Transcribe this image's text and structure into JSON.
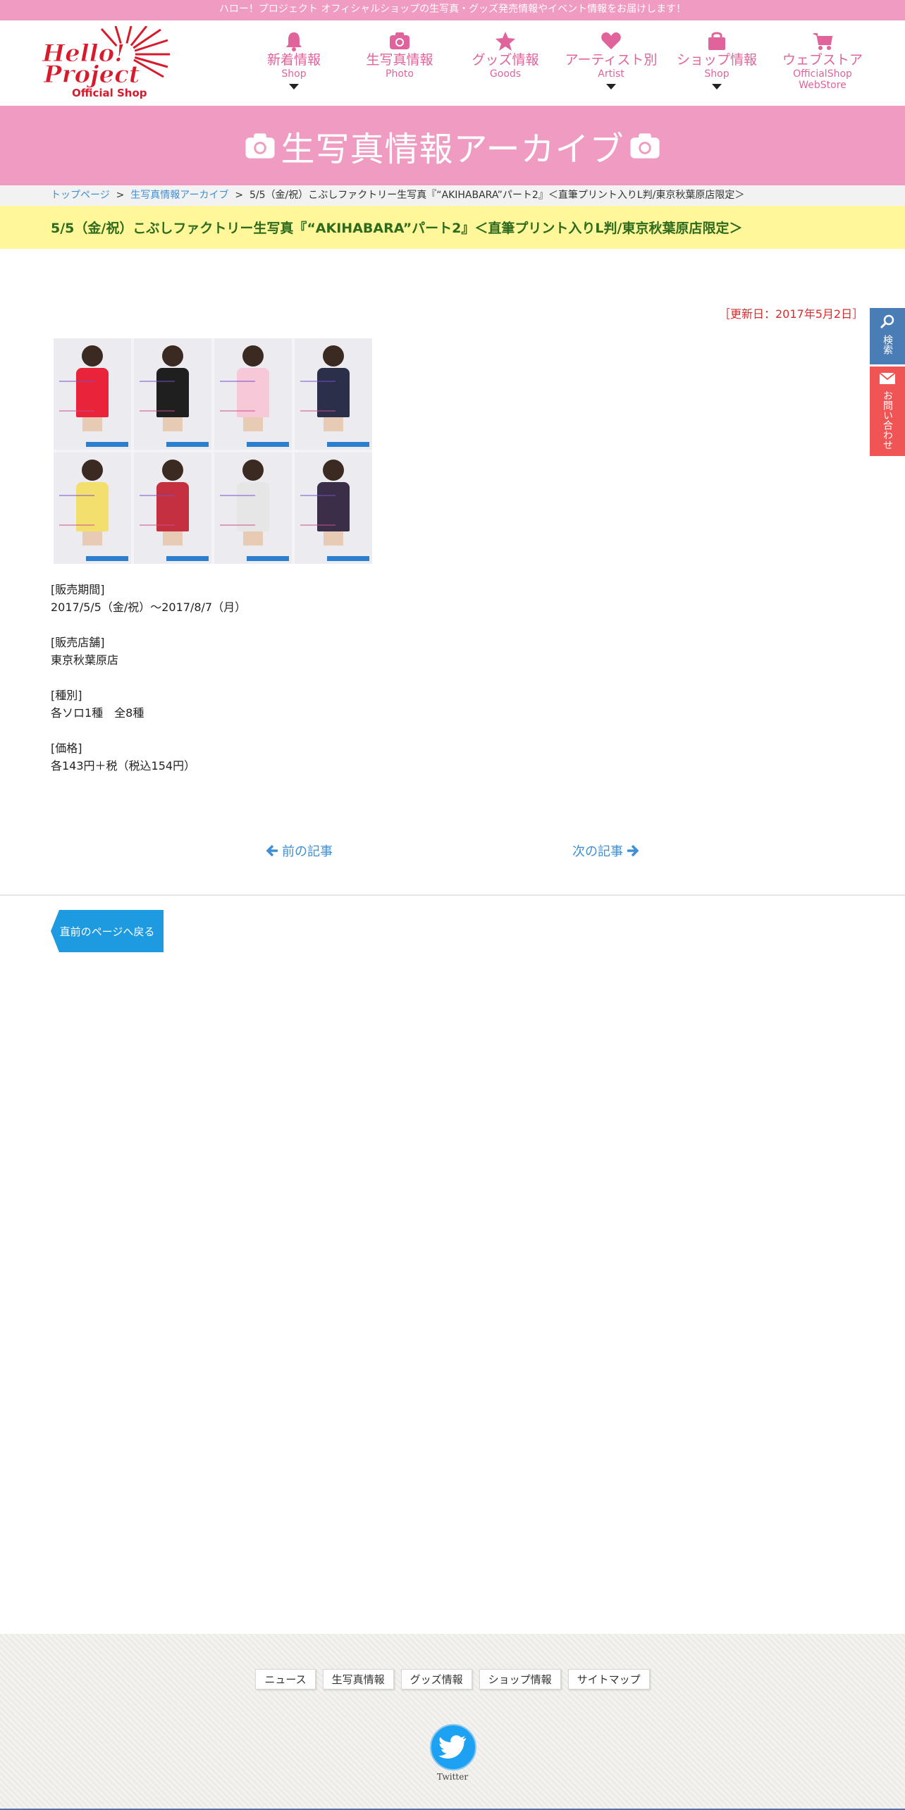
{
  "topbar": {
    "text": "ハロー！プロジェクト オフィシャルショップの生写真・グッズ発売情報やイベント情報をお届けします！"
  },
  "logo": {
    "line1": "Hello!",
    "line2": "Project",
    "line3": "Official Shop"
  },
  "nav": [
    {
      "label": "新着情報",
      "sub": "Shop",
      "icon": "bell-icon"
    },
    {
      "label": "生写真情報",
      "sub": "Photo",
      "icon": "camera-icon"
    },
    {
      "label": "グッズ情報",
      "sub": "Goods",
      "icon": "star-icon"
    },
    {
      "label": "アーティスト別",
      "sub": "Artist",
      "icon": "heart-icon"
    },
    {
      "label": "ショップ情報",
      "sub": "Shop",
      "icon": "shopping-bag-icon"
    },
    {
      "label": "ウェブストア",
      "sub": "OfficialShop",
      "sub2": "WebStore",
      "icon": "cart-icon"
    }
  ],
  "banner": {
    "title": "生写真情報アーカイブ"
  },
  "breadcrumb": {
    "home": "トップページ",
    "archive": "生写真情報アーカイブ",
    "current": "5/5（金/祝）こぶしファクトリー生写真『“AKIHABARA”パート2』＜直筆プリント入りL判/東京秋葉原店限定＞"
  },
  "article": {
    "title": "5/5（金/祝）こぶしファクトリー生写真『“AKIHABARA”パート2』＜直筆プリント入りL判/東京秋葉原店限定＞",
    "updated": "［更新日：2017年5月2日］",
    "sections": [
      {
        "heading": "[販売期間]",
        "value": "2017/5/5（金/祝）～2017/8/7（月）"
      },
      {
        "heading": "[販売店舗]",
        "value": "東京秋葉原店"
      },
      {
        "heading": "[種別]",
        "value": "各ソロ1種　全8種"
      },
      {
        "heading": "[価格]",
        "value": "各143円＋税（税込154円）"
      }
    ]
  },
  "pager": {
    "prev": "前の記事",
    "next": "次の記事"
  },
  "back_button": "直前のページへ戻る",
  "side": {
    "search": "検索",
    "contact": "お問い合わせ"
  },
  "footer": {
    "links": [
      "ニュース",
      "生写真情報",
      "グッズ情報",
      "ショップ情報",
      "サイトマップ"
    ],
    "twitter": "Twitter"
  },
  "colors": {
    "pink": "#f09bc1",
    "nav_pink": "#e0649b",
    "yellow": "#fff799",
    "link_blue": "#3f8fd4",
    "red": "#d92b2b"
  },
  "photo_outfits": [
    "#e8233a",
    "#1f1f1f",
    "#f6c8d8",
    "#2b2f4a",
    "#f3df6e",
    "#c43040",
    "#e6e6e6",
    "#3a2e48"
  ]
}
